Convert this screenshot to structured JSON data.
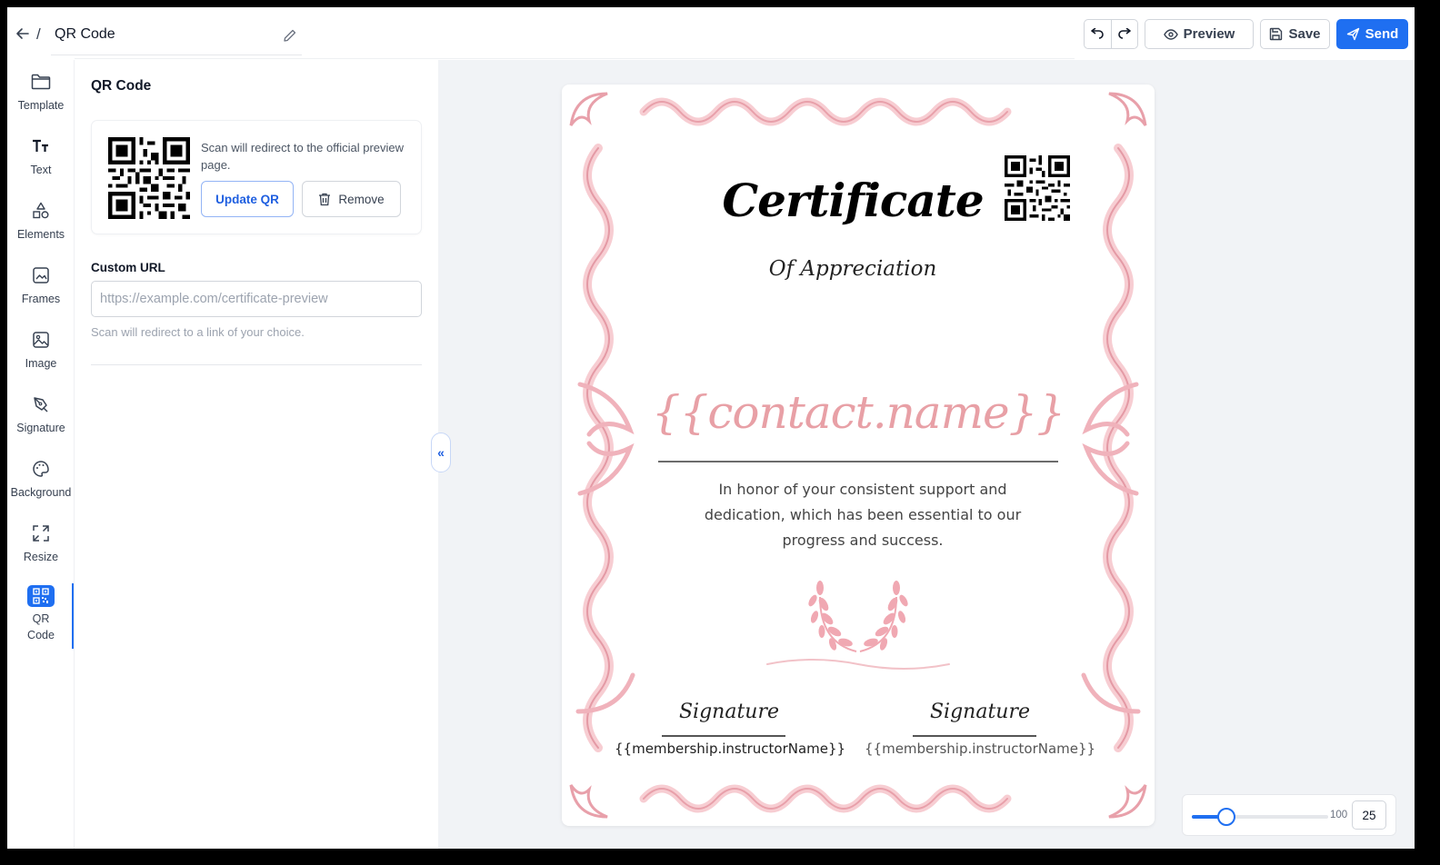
{
  "header": {
    "back_icon": "arrow-left-icon",
    "separator": "/",
    "title": "QR Code",
    "edit_icon": "pencil-icon",
    "undo_icon": "undo-icon",
    "redo_icon": "redo-icon",
    "preview_label": "Preview",
    "save_label": "Save",
    "send_label": "Send",
    "accent_color": "#1f6ff1"
  },
  "sidebar": {
    "items": [
      {
        "label": "Template",
        "icon": "folder-icon"
      },
      {
        "label": "Text",
        "icon": "text-icon"
      },
      {
        "label": "Elements",
        "icon": "shapes-icon"
      },
      {
        "label": "Frames",
        "icon": "frame-icon"
      },
      {
        "label": "Image",
        "icon": "image-icon"
      },
      {
        "label": "Signature",
        "icon": "pen-icon"
      },
      {
        "label": "Background",
        "icon": "palette-icon"
      },
      {
        "label": "Resize",
        "icon": "resize-icon"
      },
      {
        "label": "QR Code",
        "icon": "qr-code-icon",
        "active": true
      }
    ]
  },
  "panel": {
    "title": "QR Code",
    "qr_description": "Scan will redirect to the official preview page.",
    "update_label": "Update QR",
    "remove_label": "Remove",
    "custom_url_label": "Custom URL",
    "custom_url_value": "",
    "custom_url_placeholder": "https://example.com/certificate-preview",
    "custom_url_help": "Scan will redirect to a link of your choice.",
    "collapse_icon": "chevrons-left-icon"
  },
  "certificate": {
    "title": "Certificate",
    "subtitle": "Of Appreciation",
    "name_placeholder": "{{contact.name}}",
    "body": "In honor of your consistent support and dedication, which has been essential to our progress and success.",
    "signature_label_1": "Signature",
    "signature_label_2": "Signature",
    "signer_1": "{{membership.instructorName}}",
    "signer_2": "{{membership.instructorName}}",
    "border_color": "#f2b8c0",
    "name_color": "#e8a0a6"
  },
  "zoom": {
    "max_label": "100",
    "value": "25",
    "level": 0.25
  }
}
